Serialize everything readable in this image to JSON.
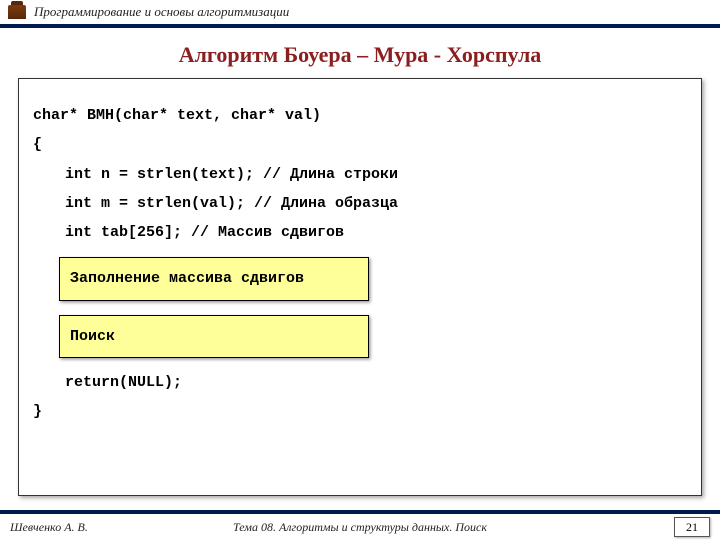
{
  "header": {
    "course": "Программирование и основы алгоритмизации"
  },
  "title": "Алгоритм Боуера – Мура - Хорспула",
  "code": {
    "line1": "char* BMH(char* text, char* val)",
    "line2": "{",
    "line3": "int n = strlen(text);    // Длина строки",
    "line4": "int m = strlen(val);  // Длина образца",
    "line5": "int tab[256];            // Массив сдвигов",
    "box1": "Заполнение массива сдвигов",
    "box2": "Поиск",
    "line6": "return(NULL);",
    "line7": "}"
  },
  "footer": {
    "author": "Шевченко А. В.",
    "topic": "Тема 08. Алгоритмы и структуры данных. Поиск",
    "page": "21"
  }
}
